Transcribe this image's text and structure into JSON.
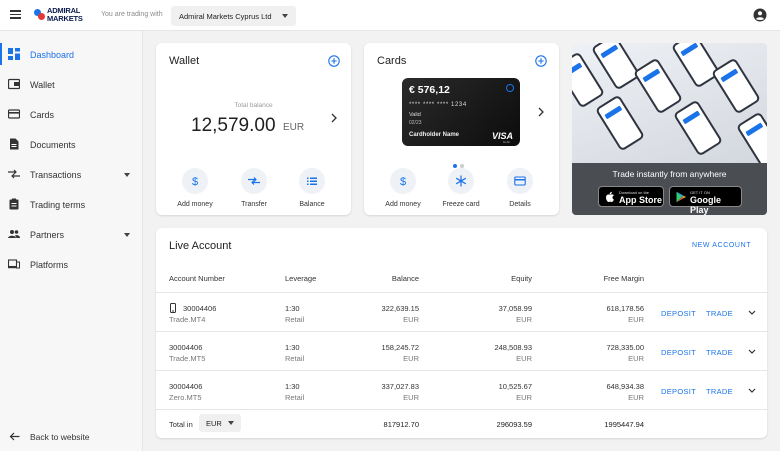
{
  "topbar": {
    "logo_line1": "ADMIRAL",
    "logo_line2": "MARKETS",
    "trading_with_label": "You are trading with",
    "company": "Admiral Markets Cyprus Ltd"
  },
  "sidebar": {
    "items": [
      {
        "label": "Dashboard",
        "icon": "dashboard-icon"
      },
      {
        "label": "Wallet",
        "icon": "wallet-icon"
      },
      {
        "label": "Cards",
        "icon": "credit-card-icon"
      },
      {
        "label": "Documents",
        "icon": "document-icon"
      },
      {
        "label": "Transactions",
        "icon": "transactions-icon"
      },
      {
        "label": "Trading terms",
        "icon": "clipboard-icon"
      },
      {
        "label": "Partners",
        "icon": "people-icon"
      },
      {
        "label": "Platforms",
        "icon": "devices-icon"
      }
    ],
    "active_index": 0,
    "back_label": "Back to website"
  },
  "wallet": {
    "title": "Wallet",
    "total_label": "Total balance",
    "balance": "12,579.00",
    "currency": "EUR",
    "actions": [
      {
        "label": "Add money",
        "icon": "dollar-icon"
      },
      {
        "label": "Transfer",
        "icon": "transfer-icon"
      },
      {
        "label": "Balance",
        "icon": "list-icon"
      }
    ]
  },
  "cards": {
    "title": "Cards",
    "card": {
      "amount": "€ 576,12",
      "number": "**** **** **** 1234",
      "valid_label": "Valid",
      "expiry": "02/23",
      "holder": "Cardholder Name",
      "brand": "VISA",
      "brand_sub": "Debit"
    },
    "actions": [
      {
        "label": "Add money",
        "icon": "dollar-icon"
      },
      {
        "label": "Freeze card",
        "icon": "snowflake-icon"
      },
      {
        "label": "Details",
        "icon": "card-icon"
      }
    ]
  },
  "promo": {
    "slogan": "Trade instantly from anywhere",
    "appstore_small": "Download on the",
    "appstore_big": "App Store",
    "googleplay_small": "GET IT ON",
    "googleplay_big": "Google Play"
  },
  "live_account": {
    "title": "Live Account",
    "new_account": "NEW ACCOUNT",
    "columns": [
      "Account Number",
      "Leverage",
      "Balance",
      "Equity",
      "Free Margin"
    ],
    "rows": [
      {
        "number": "30004406",
        "type": "Trade.MT4",
        "leverage": "1:30",
        "lev_type": "Retail",
        "balance": "322,639.15",
        "balance_cur": "EUR",
        "equity": "37,058.99",
        "equity_cur": "EUR",
        "free_margin": "618,178.56",
        "free_margin_cur": "EUR",
        "has_phone_icon": true
      },
      {
        "number": "30004406",
        "type": "Trade.MT5",
        "leverage": "1:30",
        "lev_type": "Retail",
        "balance": "158,245.72",
        "balance_cur": "EUR",
        "equity": "248,508.93",
        "equity_cur": "EUR",
        "free_margin": "728,335.00",
        "free_margin_cur": "EUR",
        "has_phone_icon": false
      },
      {
        "number": "30004406",
        "type": "Zero.MT5",
        "leverage": "1:30",
        "lev_type": "Retail",
        "balance": "337,027.83",
        "balance_cur": "EUR",
        "equity": "10,525.67",
        "equity_cur": "EUR",
        "free_margin": "648,934.38",
        "free_margin_cur": "EUR",
        "has_phone_icon": false
      }
    ],
    "deposit_label": "DEPOSIT",
    "trade_label": "TRADE",
    "total_label": "Total in",
    "total_currency": "EUR",
    "totals": {
      "balance": "817912.70",
      "equity": "296093.59",
      "free_margin": "1995447.94"
    }
  },
  "colors": {
    "accent": "#1a73e8",
    "background": "#f2f2f2"
  }
}
